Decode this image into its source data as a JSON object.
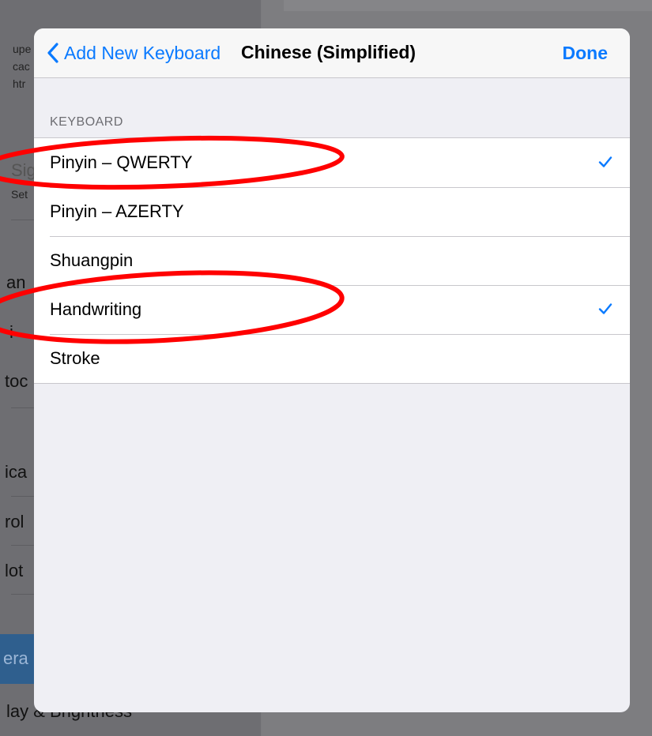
{
  "background": {
    "left_fragments": [
      "upe",
      "cac",
      "htr",
      "Sig",
      "Set",
      "an",
      "i",
      "toc",
      "ica",
      "rol",
      "lot",
      "era",
      "lay & Brightness"
    ]
  },
  "nav": {
    "back_label": "Add New Keyboard",
    "title": "Chinese (Simplified)",
    "done_label": "Done"
  },
  "section": {
    "header": "KEYBOARD"
  },
  "keyboards": [
    {
      "label": "Pinyin – QWERTY",
      "checked": true
    },
    {
      "label": "Pinyin – AZERTY",
      "checked": false
    },
    {
      "label": "Shuangpin",
      "checked": false
    },
    {
      "label": "Handwriting",
      "checked": true
    },
    {
      "label": "Stroke",
      "checked": false
    }
  ],
  "colors": {
    "accent": "#0a7aff",
    "annotation": "#ff0000"
  }
}
